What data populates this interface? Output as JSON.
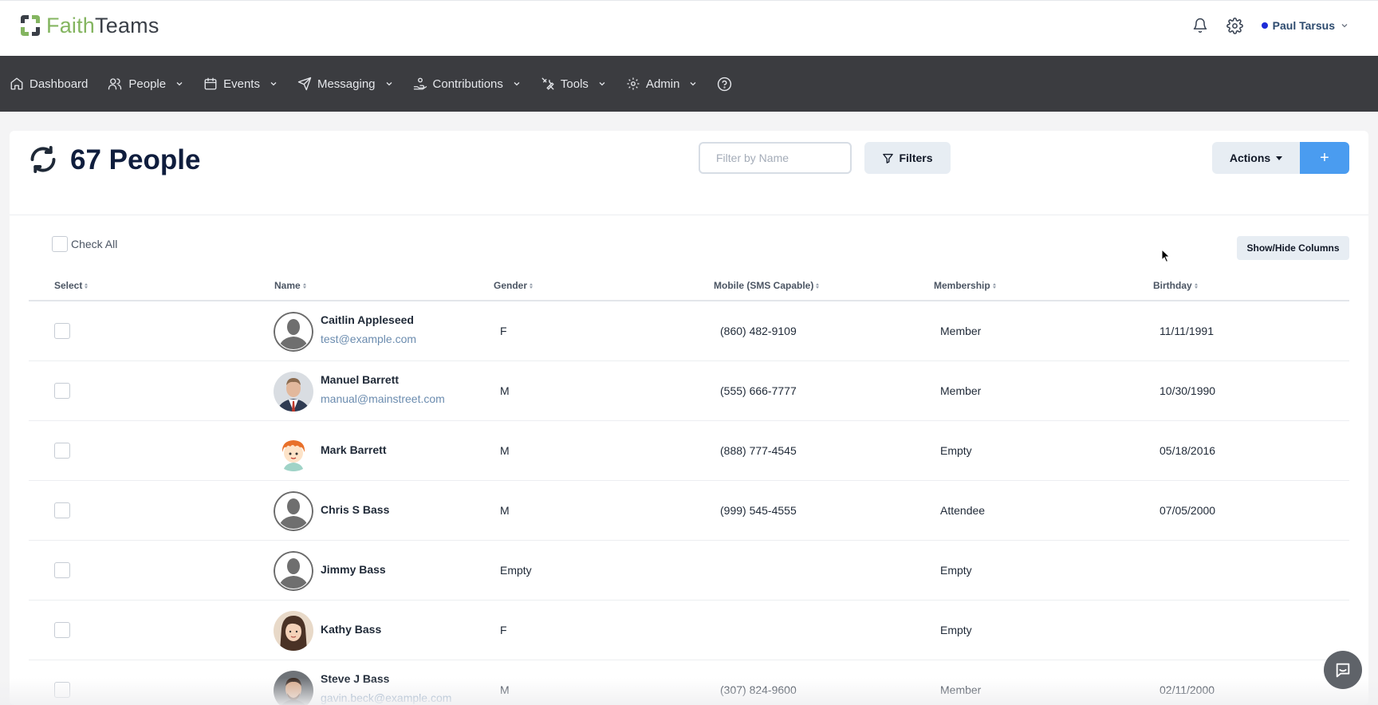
{
  "app": {
    "logo_part1": "Faith",
    "logo_part2": "Teams",
    "brand_green": "#84b560",
    "user_name": "Paul Tarsus",
    "icons": [
      "bell-icon",
      "gear-icon",
      "chevron-down-icon"
    ]
  },
  "nav": {
    "dashboard": "Dashboard",
    "people": "People",
    "events": "Events",
    "messaging": "Messaging",
    "contributions": "Contributions",
    "tools": "Tools",
    "admin": "Admin",
    "help_icon": "question-circle-icon",
    "bar_color": "#3b3c40"
  },
  "page": {
    "title": "67 People",
    "filter_placeholder": "Filter by Name",
    "filter_value": "",
    "filters_label": "Filters",
    "actions_label": "Actions",
    "add_label": "+",
    "check_all_label": "Check All",
    "show_hide_label": "Show/Hide Columns",
    "accent_blue": "#4a9cf0"
  },
  "table": {
    "headers": {
      "select": "Select",
      "name": "Name",
      "gender": "Gender",
      "mobile": "Mobile (SMS Capable)",
      "membership": "Membership",
      "birthday": "Birthday"
    },
    "rows": [
      {
        "name": "Caitlin Appleseed",
        "email": "test@example.com",
        "gender": "F",
        "mobile": "(860) 482-9109",
        "membership": "Member",
        "birthday": "11/11/1991",
        "avatar": "default-person-avatar"
      },
      {
        "name": "Manuel Barrett",
        "email": "manual@mainstreet.com",
        "gender": "M",
        "mobile": "(555) 666-7777",
        "membership": "Member",
        "birthday": "10/30/1990",
        "avatar": "man-suit-photo"
      },
      {
        "name": "Mark Barrett",
        "email": "",
        "gender": "M",
        "mobile": "(888) 777-4545",
        "membership": "Empty",
        "birthday": "05/18/2016",
        "avatar": "cartoon-child-avatar"
      },
      {
        "name": "Chris S Bass",
        "email": "",
        "gender": "M",
        "mobile": "(999) 545-4555",
        "membership": "Attendee",
        "birthday": "07/05/2000",
        "avatar": "default-person-avatar"
      },
      {
        "name": "Jimmy Bass",
        "email": "",
        "gender": "Empty",
        "mobile": "",
        "membership": "Empty",
        "birthday": "",
        "avatar": "default-person-avatar"
      },
      {
        "name": "Kathy Bass",
        "email": "",
        "gender": "F",
        "mobile": "",
        "membership": "Empty",
        "birthday": "",
        "avatar": "woman-photo"
      },
      {
        "name": "Steve J Bass",
        "email": "gavin.beck@example.com",
        "gender": "M",
        "mobile": "(307) 824-9600",
        "membership": "Member",
        "birthday": "02/11/2000",
        "avatar": "man-photo"
      }
    ]
  }
}
